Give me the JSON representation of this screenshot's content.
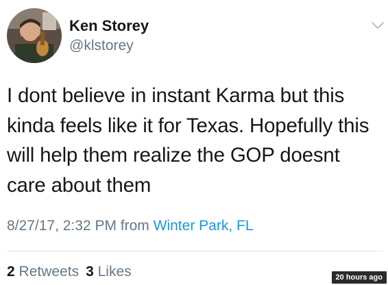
{
  "user": {
    "display_name": "Ken Storey",
    "handle": "@klstorey"
  },
  "tweet": {
    "text_lines": [
      "I dont believe in instant Karma but this",
      "kinda feels like it for Texas. Hopefully this",
      "will help them realize the GOP doesnt",
      "care about them"
    ],
    "timestamp": "8/27/17, 2:32 PM",
    "from_label": "from",
    "location": "Winter Park, FL"
  },
  "stats": {
    "retweets_count": "2",
    "retweets_label": "Retweets",
    "likes_count": "3",
    "likes_label": "Likes"
  },
  "overlay": {
    "time_ago": "20 hours ago"
  },
  "icons": {
    "menu": "chevron-down-icon"
  },
  "colors": {
    "text": "#14171a",
    "secondary": "#657786",
    "link": "#1b95e0",
    "divider": "#e1e8ed"
  }
}
